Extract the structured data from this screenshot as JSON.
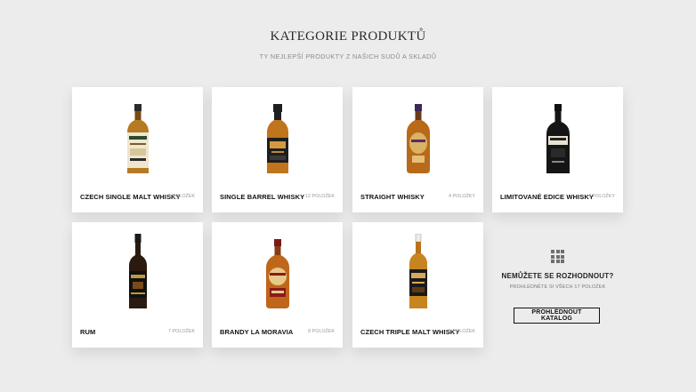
{
  "header": {
    "title": "KATEGORIE PRODUKTŮ",
    "subtitle": "TY NEJLEPŠÍ PRODUKTY Z NAŠICH SUDŮ A SKLADŮ"
  },
  "categories": [
    {
      "label": "CZECH SINGLE MALT WHISKY",
      "count": "6 POLOŽEK"
    },
    {
      "label": "SINGLE BARREL WHISKY",
      "count": "12 POLOŽEK"
    },
    {
      "label": "STRAIGHT WHISKY",
      "count": "4 POLOŽKY"
    },
    {
      "label": "LIMITOVANÉ EDICE WHISKY",
      "count": "4 POLOŽKY"
    },
    {
      "label": "RUM",
      "count": "7 POLOŽEK"
    },
    {
      "label": "BRANDY LA MORAVIA",
      "count": "8 POLOŽEK"
    },
    {
      "label": "CZECH TRIPLE MALT WHISKY",
      "count": "9 POLOŽEK"
    }
  ],
  "cta": {
    "question": "NEMŮŽETE SE ROZHODNOUT?",
    "subtext": "PROHLÉDNĚTE SI VŠECH 17 POLOŽEK",
    "button_label": "PROHLÉDNOUT KATALOG"
  },
  "colors": {
    "background": "#ececec",
    "card": "#ffffff",
    "text": "#111111",
    "muted": "#9a9a9a"
  }
}
